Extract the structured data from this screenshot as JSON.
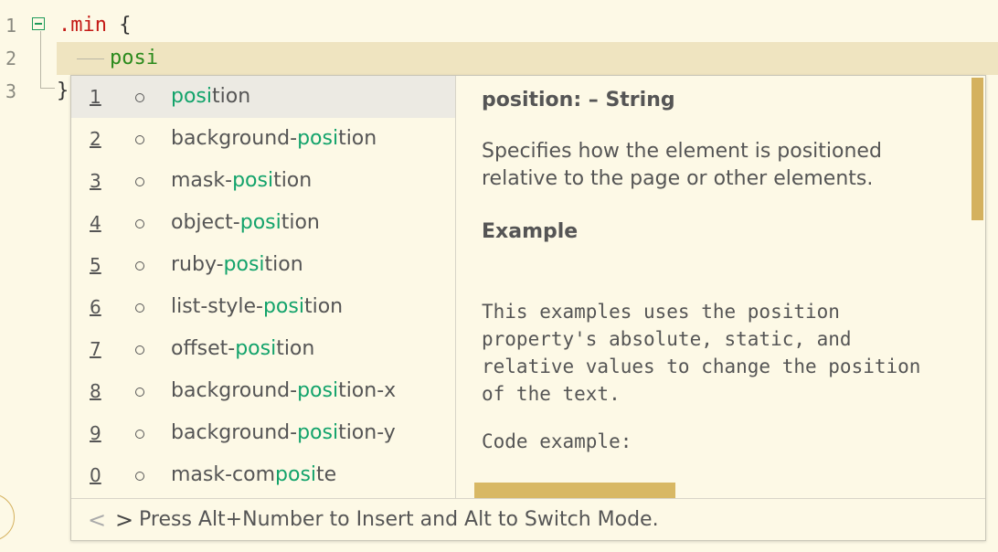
{
  "editor": {
    "lines": [
      {
        "number": "1",
        "selector": ".min",
        "brace": " {"
      },
      {
        "number": "2",
        "typed": "posi"
      },
      {
        "number": "3",
        "brace": "}"
      }
    ]
  },
  "suggest": {
    "items": [
      {
        "num": "1",
        "pre": "",
        "hl": "posi",
        "post": "tion",
        "selected": true
      },
      {
        "num": "2",
        "pre": "background-",
        "hl": "posi",
        "post": "tion"
      },
      {
        "num": "3",
        "pre": "mask-",
        "hl": "posi",
        "post": "tion"
      },
      {
        "num": "4",
        "pre": "object-",
        "hl": "posi",
        "post": "tion"
      },
      {
        "num": "5",
        "pre": "ruby-",
        "hl": "posi",
        "post": "tion"
      },
      {
        "num": "6",
        "pre": "list-style-",
        "hl": "posi",
        "post": "tion"
      },
      {
        "num": "7",
        "pre": "offset-",
        "hl": "posi",
        "post": "tion"
      },
      {
        "num": "8",
        "pre": "background-",
        "hl": "posi",
        "post": "tion-x"
      },
      {
        "num": "9",
        "pre": "background-",
        "hl": "posi",
        "post": "tion-y"
      },
      {
        "num": "0",
        "pre": "mask-com",
        "hl": "posi",
        "post": "te"
      }
    ],
    "details": {
      "title": "position: – String",
      "description": "Specifies how the element is positioned relative to the page or other elements.",
      "example_heading": "Example",
      "example_text": "This examples uses the position property's absolute, static, and relative values to change the position of the text.",
      "code_label": "Code example:"
    },
    "status": {
      "prev": "<",
      "next": ">",
      "text": "Press Alt+Number to Insert and Alt to Switch Mode."
    }
  },
  "colors": {
    "background": "#fdf9e6",
    "current_line": "#efe4c0",
    "match_highlight": "#13a36b",
    "scrollbar": "#d4b15e"
  }
}
